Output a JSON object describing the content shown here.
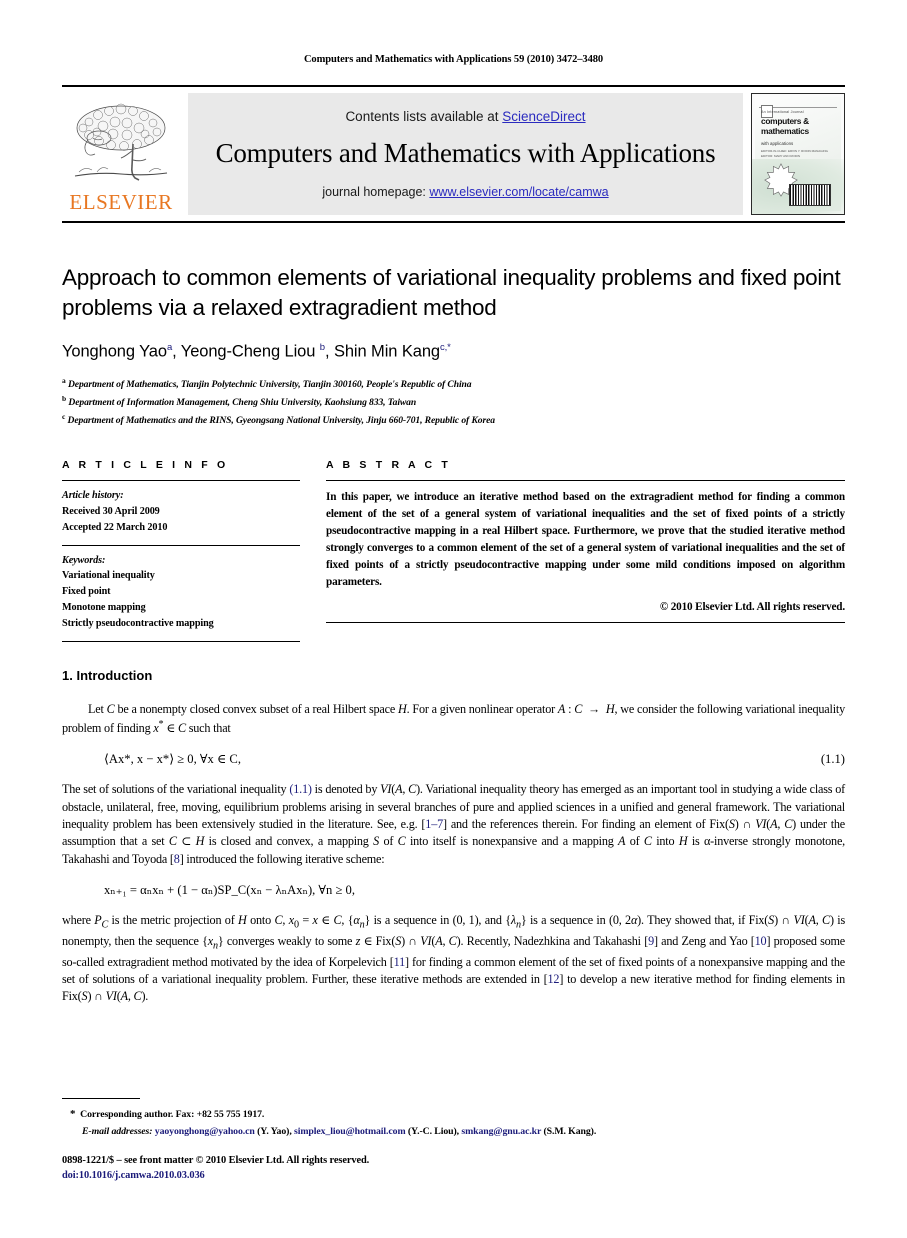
{
  "running_head": "Computers and Mathematics with Applications 59 (2010) 3472–3480",
  "masthead": {
    "publisher_name": "ELSEVIER",
    "contents_prefix": "Contents lists available at ",
    "contents_link": "ScienceDirect",
    "journal_title": "Computers and Mathematics with Applications",
    "homepage_prefix": "journal homepage: ",
    "homepage_url": "www.elsevier.com/locate/camwa",
    "cover": {
      "kicker": "An International Journal",
      "title_line1": "computers &",
      "title_line2": "mathematics",
      "subtitle": "with applications",
      "meta": "EDITOR-IN-CHIEF: ERVIN Y. RODIN\nMANAGING EDITOR: MARY ANN RODIN"
    },
    "link_color": "#2b2bbf",
    "brand_color": "#E87722"
  },
  "article": {
    "title": "Approach to common elements of variational inequality problems and fixed point problems via a relaxed extragradient method",
    "authors_html": "Yonghong Yao <sup>a</sup>, Yeong-Cheng Liou <sup>b</sup>, Shin Min Kang <sup>c,*</sup>",
    "affiliations": [
      {
        "marker": "a",
        "text": "Department of Mathematics, Tianjin Polytechnic University, Tianjin 300160, People's Republic of China"
      },
      {
        "marker": "b",
        "text": "Department of Information Management, Cheng Shiu University, Kaohsiung 833, Taiwan"
      },
      {
        "marker": "c",
        "text": "Department of Mathematics and the RINS, Gyeongsang National University, Jinju 660-701, Republic of Korea"
      }
    ]
  },
  "info": {
    "heading": "A R T I C L E   I N F O",
    "history_label": "Article history:",
    "received": "Received 30 April 2009",
    "accepted": "Accepted 22 March 2010",
    "keywords_label": "Keywords:",
    "keywords": [
      "Variational inequality",
      "Fixed point",
      "Monotone mapping",
      "Strictly pseudocontractive mapping"
    ]
  },
  "abstract": {
    "heading": "A B S T R A C T",
    "text": "In this paper, we introduce an iterative method based on the extragradient method for finding a common element of the set of a general system of variational inequalities and the set of fixed points of a strictly pseudocontractive mapping in a real Hilbert space. Furthermore, we prove that the studied iterative method strongly converges to a common element of the set of a general system of variational inequalities and the set of fixed points of a strictly pseudocontractive mapping under some mild conditions imposed on algorithm parameters.",
    "copyright": "© 2010 Elsevier Ltd. All rights reserved."
  },
  "introduction": {
    "heading": "1. Introduction",
    "para1_a": "Let C be a nonempty closed convex subset of a real Hilbert space H. For a given nonlinear operator A : C → H, we consider the following variational inequality problem of finding x",
    "para1_b": " ∈ C such that",
    "equation_1_1": "⟨Ax*, x − x*⟩ ≥ 0,    ∀x ∈ C,",
    "equation_1_1_number": "(1.1)",
    "para2": "The set of solutions of the variational inequality (1.1) is denoted by VI(A, C). Variational inequality theory has emerged as an important tool in studying a wide class of obstacle, unilateral, free, moving, equilibrium problems arising in several branches of pure and applied sciences in a unified and general framework. The variational inequality problem has been extensively studied in the literature. See, e.g. [1–7] and the references therein. For finding an element of Fix(S) ∩ VI(A, C) under the assumption that a set C ⊂ H is closed and convex, a mapping S of C into itself is nonexpansive and a mapping A of C into H is α-inverse strongly monotone, Takahashi and Toyoda [8] introduced the following iterative scheme:",
    "equation_2": "xₙ₊₁ = αₙxₙ + (1 − αₙ)SP_C(xₙ − λₙAxₙ),    ∀n ≥ 0,",
    "para3": "where P_C is the metric projection of H onto C, x₀ = x ∈ C, {αₙ} is a sequence in (0, 1), and {λₙ} is a sequence in (0, 2α). They showed that, if Fix(S) ∩ VI(A, C) is nonempty, then the sequence {xₙ} converges weakly to some z ∈ Fix(S) ∩ VI(A, C). Recently, Nadezhkina and Takahashi [9] and Zeng and Yao [10] proposed some so-called extragradient method motivated by the idea of Korpelevich [11] for finding a common element of the set of fixed points of a nonexpansive mapping and the set of solutions of a variational inequality problem. Further, these iterative methods are extended in [12] to develop a new iterative method for finding elements in Fix(S) ∩ VI(A, C)."
  },
  "footnote": {
    "corresponding": "Corresponding author. Fax: +82 55 755 1917.",
    "email_label": "E-mail addresses:",
    "emails": [
      {
        "address": "yaoyonghong@yahoo.cn",
        "owner": "(Y. Yao)"
      },
      {
        "address": "simplex_liou@hotmail.com",
        "owner": "(Y.-C. Liou)"
      },
      {
        "address": "smkang@gnu.ac.kr",
        "owner": "(S.M. Kang)"
      }
    ],
    "issn_line": "0898-1221/$ – see front matter © 2010 Elsevier Ltd. All rights reserved.",
    "doi": "doi:10.1016/j.camwa.2010.03.036"
  }
}
